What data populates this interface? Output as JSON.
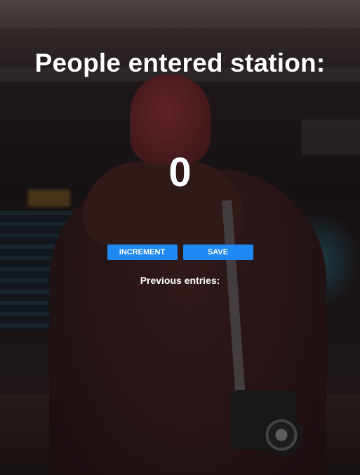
{
  "app": {
    "title": "People entered station:",
    "count": "0"
  },
  "actions": {
    "increment_label": "INCREMENT",
    "save_label": "SAVE"
  },
  "entries": {
    "label": "Previous entries:",
    "items": []
  },
  "colors": {
    "button": "#1e88f3",
    "text": "#ffffff"
  }
}
